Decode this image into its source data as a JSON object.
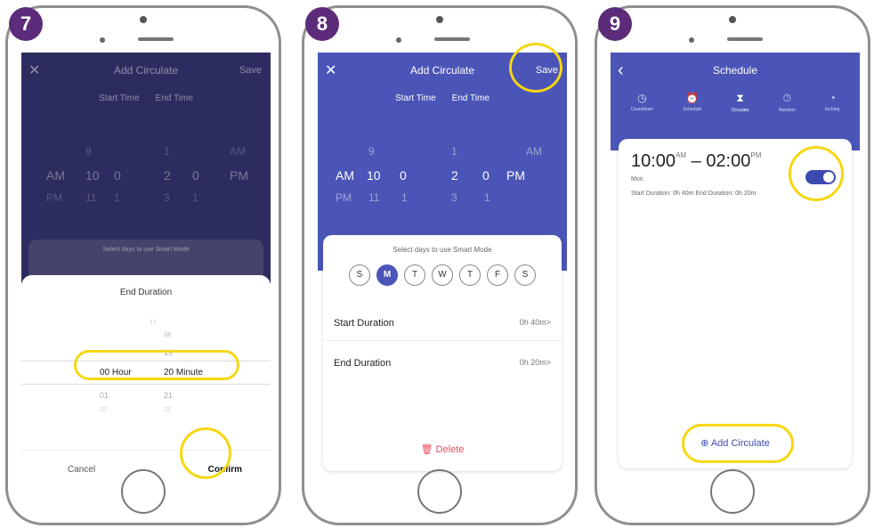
{
  "steps": [
    "7",
    "8",
    "9"
  ],
  "phone1": {
    "nav": {
      "close": "✕",
      "title": "Add Circulate",
      "save": "Save"
    },
    "time_tabs": [
      "Start Time",
      "End Time"
    ],
    "picker": {
      "row_top": [
        "9",
        "",
        "",
        "1",
        "",
        "AM"
      ],
      "row_mid": [
        "AM",
        "10",
        "0",
        "2",
        "0",
        "PM"
      ],
      "row_bot": [
        "PM",
        "11",
        "1",
        "3",
        "1",
        ""
      ]
    },
    "days_caption": "Select days to use Smart Mode",
    "sheet": {
      "title": "End Duration",
      "hours_above": [
        "",
        "",
        ""
      ],
      "minutes_above": [
        "17",
        "18",
        "19"
      ],
      "selected_hour": "00",
      "hour_unit": "Hour",
      "selected_minute": "20",
      "minute_unit": "Minute",
      "hours_below": [
        "01",
        "02"
      ],
      "minutes_below": [
        "21",
        "22"
      ],
      "cancel": "Cancel",
      "confirm": "Confirm"
    }
  },
  "phone2": {
    "nav": {
      "close": "✕",
      "title": "Add Circulate",
      "save": "Save"
    },
    "time_tabs": [
      "Start Time",
      "End Time"
    ],
    "picker": {
      "row_top": [
        "",
        "9",
        "",
        "1",
        "",
        "AM"
      ],
      "row_mid": [
        "AM",
        "10",
        "0",
        "2",
        "0",
        "PM"
      ],
      "row_bot": [
        "PM",
        "11",
        "1",
        "3",
        "1",
        ""
      ]
    },
    "days_caption": "Select days to use Smart Mode",
    "days": [
      "S",
      "M",
      "T",
      "W",
      "T",
      "F",
      "S"
    ],
    "selected_day_index": 1,
    "start_duration": {
      "label": "Start Duration",
      "value": "0h 40m>"
    },
    "end_duration": {
      "label": "End Duration",
      "value": "0h 20m>"
    },
    "delete": "Delete"
  },
  "phone3": {
    "nav": {
      "back": "‹",
      "title": "Schedule"
    },
    "modes": [
      {
        "icon": "◷",
        "label": "Countdown"
      },
      {
        "icon": "⏰",
        "label": "Schedule"
      },
      {
        "icon": "⧗",
        "label": "Circulate"
      },
      {
        "icon": "⏱",
        "label": "Random"
      },
      {
        "icon": "◔",
        "label": "Inching"
      }
    ],
    "active_mode_index": 2,
    "entry": {
      "start": "10:00",
      "start_ampm": "AM",
      "dash": "–",
      "end": "02:00",
      "end_ampm": "PM",
      "day": "Mon",
      "durations": "Start Duration: 0h 40m   End Duration: 0h 20m",
      "enabled": true
    },
    "add_button": "Add Circulate"
  },
  "colors": {
    "primary": "#4a55b7",
    "dark_overlay": "#2c2c60",
    "highlight": "#f6d711",
    "badge": "#5c2c7a",
    "delete": "#e9485a"
  }
}
